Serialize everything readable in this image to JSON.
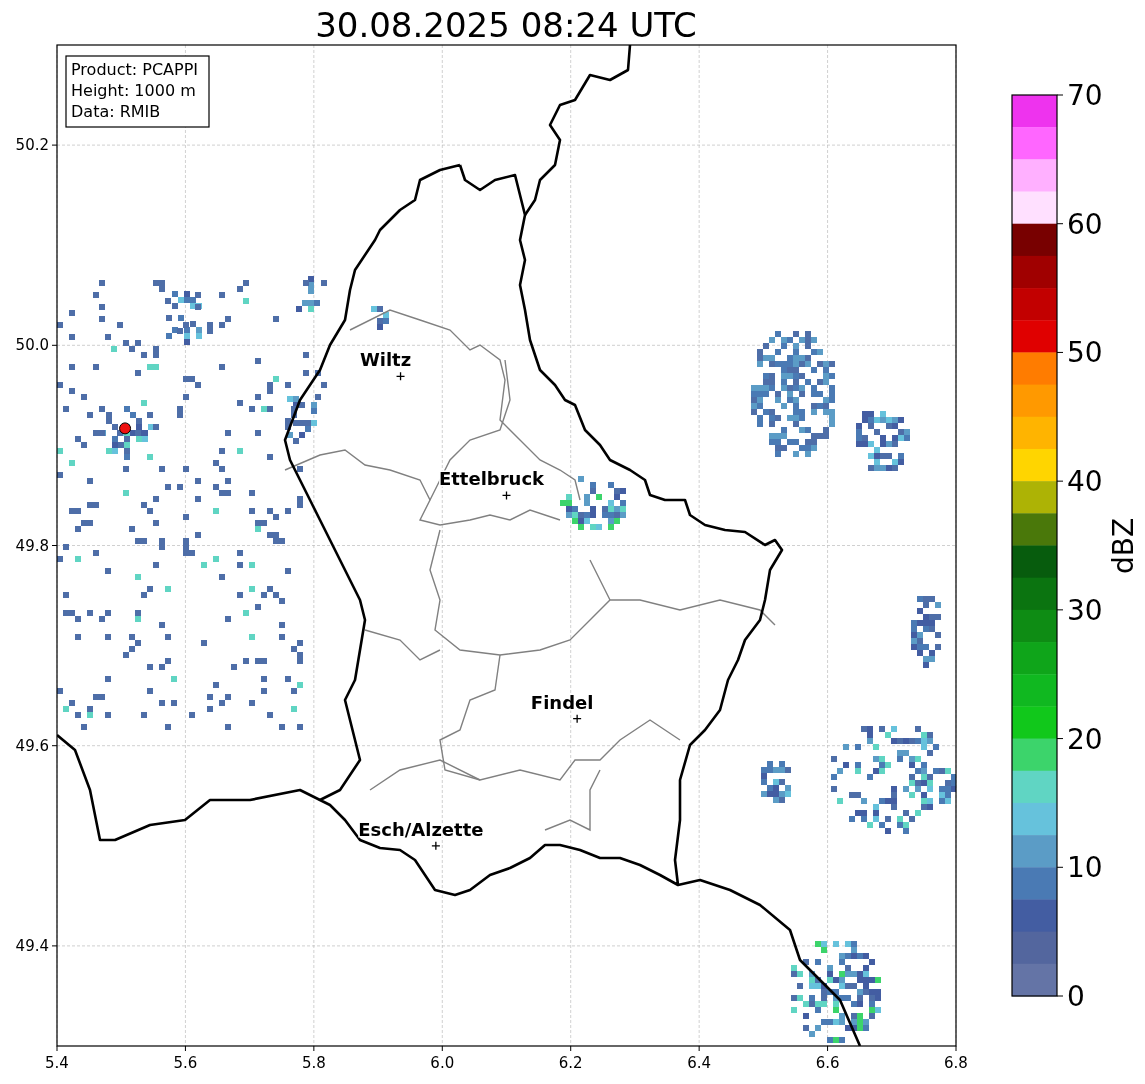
{
  "map": {
    "title": "30.08.2025 08:24 UTC",
    "x_ticks": [
      "5.4",
      "5.6",
      "5.8",
      "6.0",
      "6.2",
      "6.4",
      "6.6",
      "6.8"
    ],
    "y_ticks": [
      "50.2",
      "50.0",
      "49.8",
      "49.6",
      "49.4"
    ],
    "cities": [
      "Wiltz",
      "Ettelbruck",
      "Findel",
      "Esch/Alzette"
    ],
    "info": [
      "Product: PCAPPI",
      "Height: 1000 m",
      "Data: RMIB"
    ]
  },
  "colorbar": {
    "label": "dBZ",
    "ticks": [
      "70",
      "60",
      "50",
      "40",
      "30",
      "20",
      "10",
      "0"
    ],
    "bins": [
      {
        "color": "#ee33ee"
      },
      {
        "color": "#ff66ff"
      },
      {
        "color": "#ffb0ff"
      },
      {
        "color": "#ffe0ff"
      },
      {
        "color": "#780000"
      },
      {
        "color": "#a00000"
      },
      {
        "color": "#c20000"
      },
      {
        "color": "#e00000"
      },
      {
        "color": "#ff7c00"
      },
      {
        "color": "#ff9900"
      },
      {
        "color": "#ffb400"
      },
      {
        "color": "#ffd500"
      },
      {
        "color": "#adb305"
      },
      {
        "color": "#4a780a"
      },
      {
        "color": "#075c0d"
      },
      {
        "color": "#0b7410"
      },
      {
        "color": "#0e8c14"
      },
      {
        "color": "#0fa51a"
      },
      {
        "color": "#10b820"
      },
      {
        "color": "#11c81b"
      },
      {
        "color": "#3cd46b"
      },
      {
        "color": "#60d5c3"
      },
      {
        "color": "#66c2dc"
      },
      {
        "color": "#5b9cc6"
      },
      {
        "color": "#4a7ab4"
      },
      {
        "color": "#435da2"
      },
      {
        "color": "#53669e"
      },
      {
        "color": "#6474a6"
      }
    ]
  }
}
